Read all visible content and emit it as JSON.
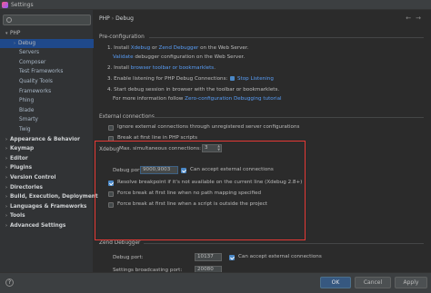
{
  "window": {
    "title": "Settings"
  },
  "sidebar": {
    "search_placeholder": "",
    "items": [
      {
        "label": "PHP",
        "level": 0,
        "expanded": true,
        "bold": false
      },
      {
        "label": "Debug",
        "level": 1,
        "selected": true
      },
      {
        "label": "Servers",
        "level": 2
      },
      {
        "label": "Composer",
        "level": 2
      },
      {
        "label": "Test Frameworks",
        "level": 2
      },
      {
        "label": "Quality Tools",
        "level": 2
      },
      {
        "label": "Frameworks",
        "level": 2
      },
      {
        "label": "Phing",
        "level": 2
      },
      {
        "label": "Blade",
        "level": 2
      },
      {
        "label": "Smarty",
        "level": 2
      },
      {
        "label": "Twig",
        "level": 2
      },
      {
        "label": "Appearance & Behavior",
        "level": 0,
        "bold": true
      },
      {
        "label": "Keymap",
        "level": 0,
        "bold": true
      },
      {
        "label": "Editor",
        "level": 0,
        "bold": true
      },
      {
        "label": "Plugins",
        "level": 0,
        "bold": true
      },
      {
        "label": "Version Control",
        "level": 0,
        "bold": true
      },
      {
        "label": "Directories",
        "level": 0,
        "bold": true
      },
      {
        "label": "Build, Execution, Deployment",
        "level": 0,
        "bold": true
      },
      {
        "label": "Languages & Frameworks",
        "level": 0,
        "bold": true
      },
      {
        "label": "Tools",
        "level": 0,
        "bold": true
      },
      {
        "label": "Advanced Settings",
        "level": 0,
        "bold": true
      }
    ]
  },
  "breadcrumb": {
    "parent": "PHP",
    "separator": "›",
    "current": "Debug"
  },
  "preconfig": {
    "title": "Pre-configuration",
    "step1_prefix": "1. Install ",
    "step1_link1": "Xdebug",
    "step1_or": " or ",
    "step1_link2": "Zend Debugger",
    "step1_suffix": " on the Web Server.",
    "validate_link": "Validate",
    "validate_suffix": " debugger configuration on the Web Server.",
    "step2_prefix": "2. Install ",
    "step2_link": "browser toolbar or bookmarklets",
    "step2_suffix": ".",
    "step3_prefix": "3. Enable listening for PHP Debug Connections:",
    "step3_link": "Stop Listening",
    "step4": "4. Start debug session in browser with the toolbar or bookmarklets.",
    "more_prefix": "For more information follow ",
    "more_link": "Zero-configuration Debugging tutorial"
  },
  "external": {
    "title": "External connections",
    "ignore_label": "Ignore external connections through unregistered server configurations",
    "break_first_label": "Break at first line in PHP scripts",
    "max_label": "Max. simultaneous connections:",
    "max_value": "3"
  },
  "xdebug": {
    "title": "Xdebug",
    "port_label": "Debug port:",
    "port_value": "9000,9003",
    "accept_label": "Can accept external connections",
    "resolve_label": "Resolve breakpoint if it's not available on the current line (Xdebug 2.8+)",
    "force_no_mapping_label": "Force break at first line when no path mapping specified",
    "force_outside_label": "Force break at first line when a script is outside the project"
  },
  "zend": {
    "title": "Zend Debugger",
    "port_label": "Debug port:",
    "port_value": "10137",
    "accept_label": "Can accept external connections",
    "broadcast_label": "Settings broadcasting port:",
    "broadcast_value": "20080"
  },
  "footer": {
    "help_icon": "?",
    "ok_label": "OK",
    "cancel_label": "Cancel",
    "apply_label": "Apply"
  },
  "colors": {
    "accent": "#4a88c7",
    "link": "#589df6",
    "highlight": "#e53935",
    "background": "#2b2b2b"
  }
}
